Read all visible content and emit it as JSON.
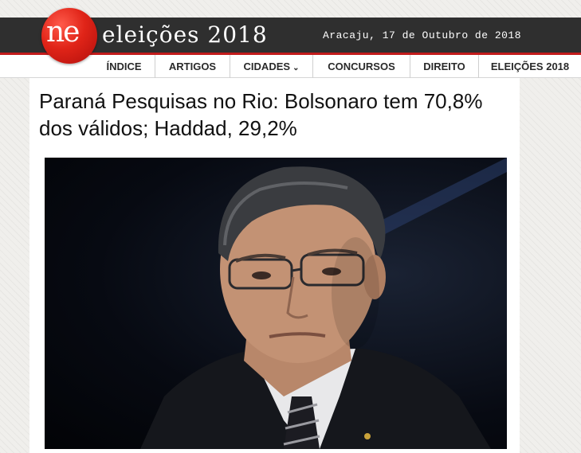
{
  "logo": {
    "text": "ne"
  },
  "header": {
    "site_title": "eleições 2018",
    "date": "Aracaju, 17 de Outubro de 2018"
  },
  "nav": {
    "items": [
      {
        "label": "ÍNDICE"
      },
      {
        "label": "ARTIGOS"
      },
      {
        "label": "CIDADES",
        "chevron": "chevron-down-icon"
      },
      {
        "label": "CONCURSOS"
      },
      {
        "label": "DIREITO"
      },
      {
        "label": "ELEIÇÕES 2018"
      }
    ]
  },
  "article": {
    "headline": "Paraná Pesquisas no Rio: Bolsonaro tem 70,8% dos válidos; Haddad, 29,2%"
  },
  "colors": {
    "header_bg": "#2f2f2f",
    "accent_red": "#c21b1b",
    "logo_red": "#e02418"
  }
}
